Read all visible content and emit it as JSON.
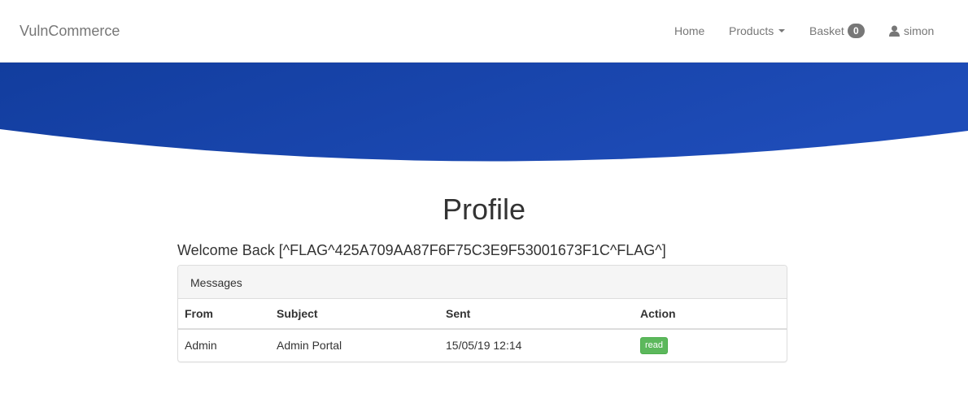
{
  "nav": {
    "brand": "VulnCommerce",
    "home": "Home",
    "products": "Products",
    "basket": "Basket",
    "basket_count": "0",
    "user": "simon"
  },
  "hero": {
    "color_start": "#123d9e",
    "color_end": "#1e4cb8"
  },
  "profile": {
    "title": "Profile",
    "welcome": "Welcome Back [^FLAG^425A709AA87F6F75C3E9F53001673F1C^FLAG^]"
  },
  "messages": {
    "heading": "Messages",
    "columns": [
      "From",
      "Subject",
      "Sent",
      "Action"
    ],
    "rows": [
      {
        "from": "Admin",
        "subject": "Admin Portal",
        "sent": "15/05/19 12:14",
        "action": "read"
      }
    ]
  },
  "colors": {
    "action_green": "#5cb85c",
    "badge_gray": "#777777"
  },
  "icons": {
    "user": "user-icon",
    "products_caret": "caret-down-icon"
  }
}
